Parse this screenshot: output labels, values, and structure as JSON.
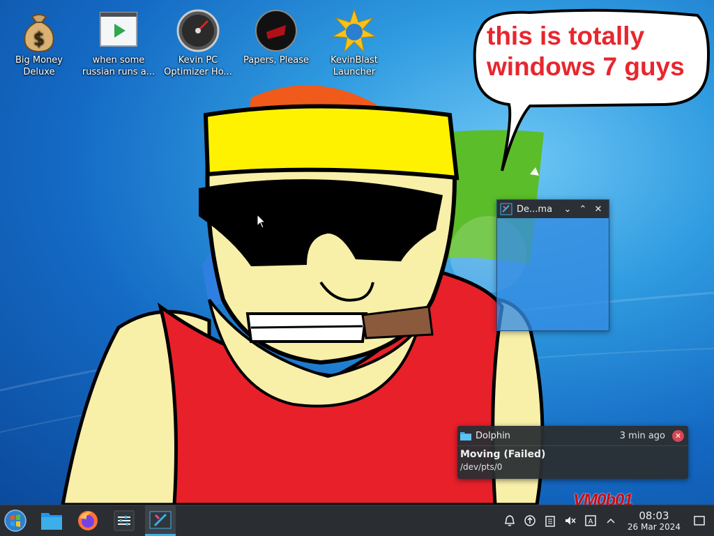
{
  "desktop": {
    "icons": [
      {
        "label": "Big Money Deluxe",
        "icon": "money-bag-icon"
      },
      {
        "label": "when some russian runs a...",
        "icon": "video-player-icon"
      },
      {
        "label": "Kevin PC Optimizer Ho...",
        "icon": "speedometer-icon"
      },
      {
        "label": "Papers, Please",
        "icon": "papers-please-icon"
      },
      {
        "label": "KevinBlast Launcher",
        "icon": "kevinblast-icon"
      }
    ],
    "speech_bubble": {
      "line1": "this is totally",
      "line2": "windows 7 guys"
    },
    "watermark": "VM0b01"
  },
  "mini_window": {
    "title": "De...ma",
    "buttons": [
      "minimize",
      "maximize",
      "close"
    ]
  },
  "notification": {
    "app": "Dolphin",
    "time": "3 min ago",
    "summary": "Moving (Failed)",
    "body": "/dev/pts/0"
  },
  "taskbar": {
    "apps": [
      {
        "name": "start-menu",
        "icon": "windows-orb-icon"
      },
      {
        "name": "dolphin",
        "icon": "folder-icon"
      },
      {
        "name": "firefox",
        "icon": "firefox-icon"
      },
      {
        "name": "system-settings",
        "icon": "settings-icon"
      },
      {
        "name": "desktop-manager",
        "icon": "window-app-icon",
        "active": true
      }
    ],
    "tray": [
      "notifications-icon",
      "updates-icon",
      "clipboard-icon",
      "volume-muted-icon",
      "input-method-icon",
      "expand-tray-icon"
    ],
    "clock": {
      "time": "08:03",
      "date": "26 Mar 2024"
    }
  },
  "colors": {
    "accent": "#3daee9",
    "panel": "#2a2e32",
    "bubble_text": "#e8262e",
    "notif_close": "#da4453"
  }
}
